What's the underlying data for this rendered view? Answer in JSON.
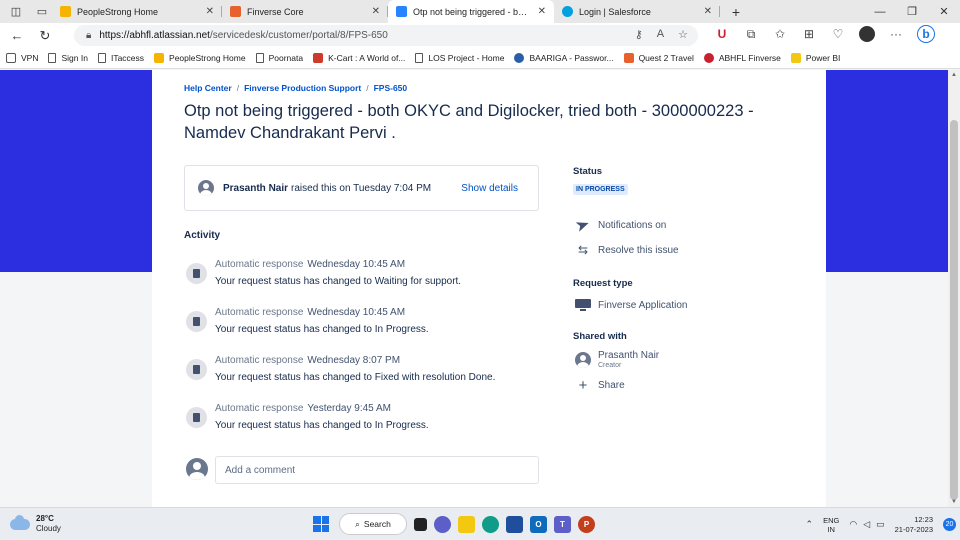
{
  "browser": {
    "tabs": [
      {
        "title": "PeopleStrong Home",
        "color": "#f5b400",
        "active": false
      },
      {
        "title": "Finverse Core",
        "color": "#e8612c",
        "active": false
      },
      {
        "title": "Otp not being triggered - both O",
        "color": "#2684ff",
        "active": true
      },
      {
        "title": "Login | Salesforce",
        "color": "#00a1e0",
        "active": false
      }
    ],
    "new_tab": "+",
    "url_host": "https://abhfl.atlassian.net",
    "url_path": "/servicedesk/customer/portal/8/FPS-650",
    "bookmarks": [
      {
        "label": "VPN",
        "icon": "doc-icon"
      },
      {
        "label": "Sign In",
        "icon": "doc-icon"
      },
      {
        "label": "ITaccess",
        "icon": "doc-icon"
      },
      {
        "label": "PeopleStrong Home",
        "icon": "peoplestrong-icon",
        "color": "#f5b400"
      },
      {
        "label": "Poornata",
        "icon": "doc-icon"
      },
      {
        "label": "K-Cart : A World of...",
        "icon": "kcart-icon",
        "color": "#d03a2a"
      },
      {
        "label": "LOS Project - Home",
        "icon": "doc-icon"
      },
      {
        "label": "BAARIGA - Passwor...",
        "icon": "baariga-icon",
        "color": "#2c5ea8"
      },
      {
        "label": "Quest 2 Travel",
        "icon": "quest-icon",
        "color": "#e8612c"
      },
      {
        "label": "ABHFL Finverse",
        "icon": "finverse-icon",
        "color": "#c8202f"
      },
      {
        "label": "Power BI",
        "icon": "powerbi-icon",
        "color": "#f2c811"
      }
    ]
  },
  "portal": {
    "breadcrumb": [
      "Help Center",
      "Finverse Production Support",
      "FPS-650"
    ],
    "title": "Otp not being triggered - both OKYC and Digilocker, tried both - 3000000223 - Namdev Chandrakant Pervi .",
    "raised": {
      "name": "Prasanth Nair",
      "text": "raised this on Tuesday 7:04 PM",
      "show_details": "Show details"
    },
    "activity_heading": "Activity",
    "activity": [
      {
        "who": "Automatic response",
        "when": "Wednesday 10:45 AM",
        "text": "Your request status has changed to Waiting for support."
      },
      {
        "who": "Automatic response",
        "when": "Wednesday 10:45 AM",
        "text": "Your request status has changed to In Progress."
      },
      {
        "who": "Automatic response",
        "when": "Wednesday 8:07 PM",
        "text": "Your request status has changed to Fixed with resolution Done."
      },
      {
        "who": "Automatic response",
        "when": "Yesterday 9:45 AM",
        "text": "Your request status has changed to In Progress."
      }
    ],
    "comment_placeholder": "Add a comment",
    "sidebar": {
      "status_heading": "Status",
      "status_value": "IN PROGRESS",
      "notifications": "Notifications on",
      "resolve": "Resolve this issue",
      "request_type_heading": "Request type",
      "request_type": "Finverse Application",
      "shared_heading": "Shared with",
      "shared_name": "Prasanth Nair",
      "shared_role": "Creator",
      "share": "Share"
    },
    "colors": {
      "banner": "#2c2fe0",
      "link": "#0052cc"
    }
  },
  "taskbar": {
    "weather_temp": "28°C",
    "weather_desc": "Cloudy",
    "search": "Search",
    "lang1": "ENG",
    "lang2": "IN",
    "time": "12:23",
    "date": "21-07-2023",
    "notifications": "20"
  }
}
